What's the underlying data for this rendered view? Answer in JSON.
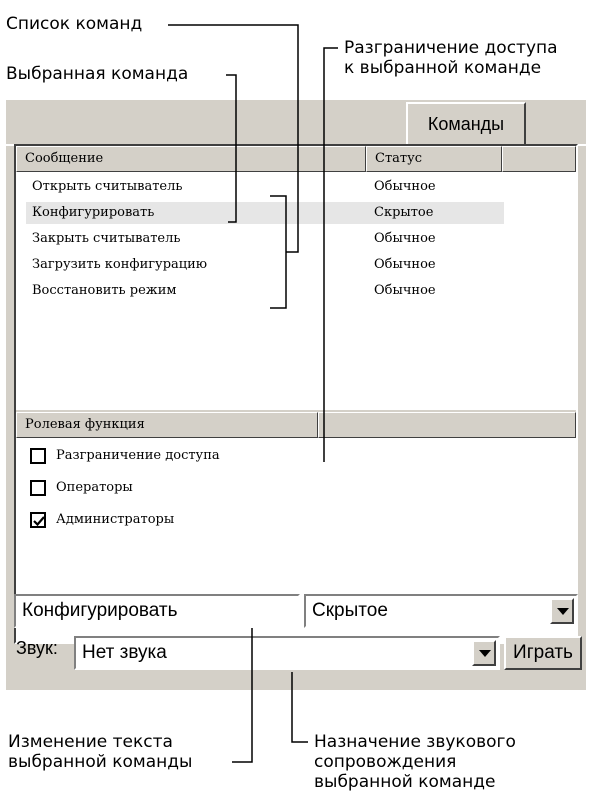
{
  "callouts": {
    "command_list": "Список команд",
    "selected_command": "Выбранная команда",
    "access_control": "Разграничение доступа\nк выбранной команде",
    "edit_text": "Изменение текста\nвыбранной команды",
    "sound_assign": "Назначение звукового\nсопровождения\nвыбранной команде"
  },
  "tab": {
    "label": "Команды"
  },
  "commands": {
    "headers": {
      "message": "Сообщение",
      "status": "Статус"
    },
    "rows": [
      {
        "message": "Открыть считыватель",
        "status": "Обычное",
        "selected": false
      },
      {
        "message": "Конфигурировать",
        "status": "Скрытое",
        "selected": true
      },
      {
        "message": "Закрыть считыватель",
        "status": "Обычное",
        "selected": false
      },
      {
        "message": "Загрузить конфигурацию",
        "status": "Обычное",
        "selected": false
      },
      {
        "message": "Восстановить режим",
        "status": "Обычное",
        "selected": false
      }
    ]
  },
  "roles": {
    "header": "Ролевая функция",
    "items": [
      {
        "label": "Разграничение доступа",
        "checked": false
      },
      {
        "label": "Операторы",
        "checked": false
      },
      {
        "label": "Администраторы",
        "checked": true
      }
    ]
  },
  "editor": {
    "command_text": "Конфигурировать",
    "status_value": "Скрытое",
    "sound_label": "Звук:",
    "sound_value": "Нет звука",
    "play_button": "Играть"
  }
}
